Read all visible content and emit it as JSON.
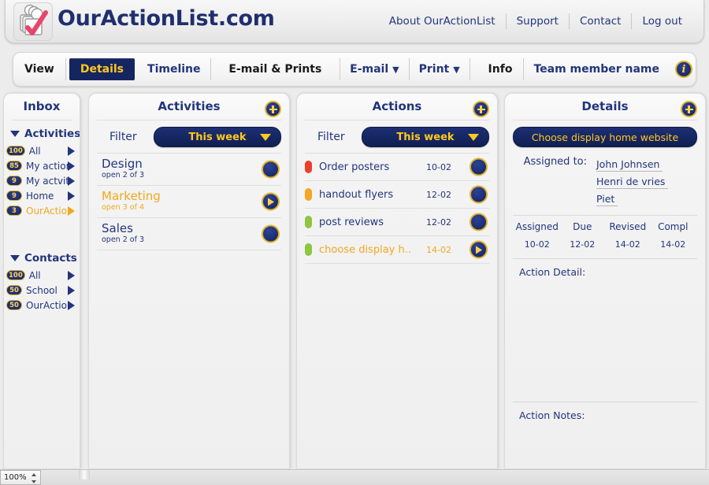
{
  "header": {
    "brand": "OurActionList.com",
    "logo_icon": "stacked-cards-check-icon",
    "nav": [
      {
        "label": "About OurActionList"
      },
      {
        "label": "Support"
      },
      {
        "label": "Contact"
      },
      {
        "label": "Log out"
      }
    ]
  },
  "toolbar": {
    "view_label": "View",
    "tabs": [
      {
        "label": "Details",
        "active": true
      },
      {
        "label": "Timeline",
        "active": false
      }
    ],
    "email_prints_label": "E-mail & Prints",
    "email_menu": "E-mail",
    "print_menu": "Print",
    "info_label": "Info",
    "team_member_label": "Team member name",
    "info_badge_glyph": "i",
    "caret_glyph": "▼"
  },
  "sidebar": {
    "title": "Inbox",
    "groups": [
      {
        "label": "Activities",
        "items": [
          {
            "count": "100",
            "label": "All",
            "selected": false
          },
          {
            "count": "85",
            "label": "My action",
            "selected": false
          },
          {
            "count": "9",
            "label": "My actvity",
            "selected": false
          },
          {
            "count": "9",
            "label": "Home",
            "selected": false
          },
          {
            "count": "3",
            "label": "OurActio..",
            "selected": true
          }
        ]
      },
      {
        "label": "Contacts",
        "items": [
          {
            "count": "100",
            "label": "All",
            "selected": false
          },
          {
            "count": "50",
            "label": "School",
            "selected": false
          },
          {
            "count": "50",
            "label": "OurActio..",
            "selected": false
          }
        ]
      }
    ]
  },
  "activities": {
    "title": "Activities",
    "filter_label": "Filter",
    "filter_value": "This week",
    "items": [
      {
        "name": "Design",
        "sub": "open 2 of 3",
        "selected": false
      },
      {
        "name": "Marketing",
        "sub": "open 3 of 4",
        "selected": true
      },
      {
        "name": "Sales",
        "sub": "open 2 of 3",
        "selected": false
      }
    ]
  },
  "actions": {
    "title": "Actions",
    "filter_label": "Filter",
    "filter_value": "This week",
    "items": [
      {
        "name": "Order posters",
        "date": "10-02",
        "color": "#e8402a",
        "selected": false
      },
      {
        "name": "handout flyers",
        "date": "12-02",
        "color": "#f5a623",
        "selected": false
      },
      {
        "name": "post reviews",
        "date": "12-02",
        "color": "#8dc63f",
        "selected": false
      },
      {
        "name": "choose display h..",
        "date": "14-02",
        "color": "#8dc63f",
        "selected": true
      }
    ]
  },
  "details": {
    "title": "Details",
    "action_title": "Choose display home website",
    "assigned_to_label": "Assigned to:",
    "assignees": [
      "John Johnsen",
      "Henri de vries",
      "Piet"
    ],
    "date_headers": [
      "Assigned",
      "Due",
      "Revised",
      "Compl"
    ],
    "date_values": [
      "10-02",
      "12-02",
      "14-02",
      "14-02"
    ],
    "action_detail_label": "Action Detail:",
    "action_detail_value": "",
    "action_notes_label": "Action Notes:",
    "action_notes_value": ""
  },
  "statusbar": {
    "zoom_value": "100%"
  },
  "colors": {
    "navy": "#22357c",
    "dark_navy": "#15255f",
    "gold": "#ffc81f",
    "selected_orange": "#f0a81e",
    "badge_border": "#e0b227"
  }
}
